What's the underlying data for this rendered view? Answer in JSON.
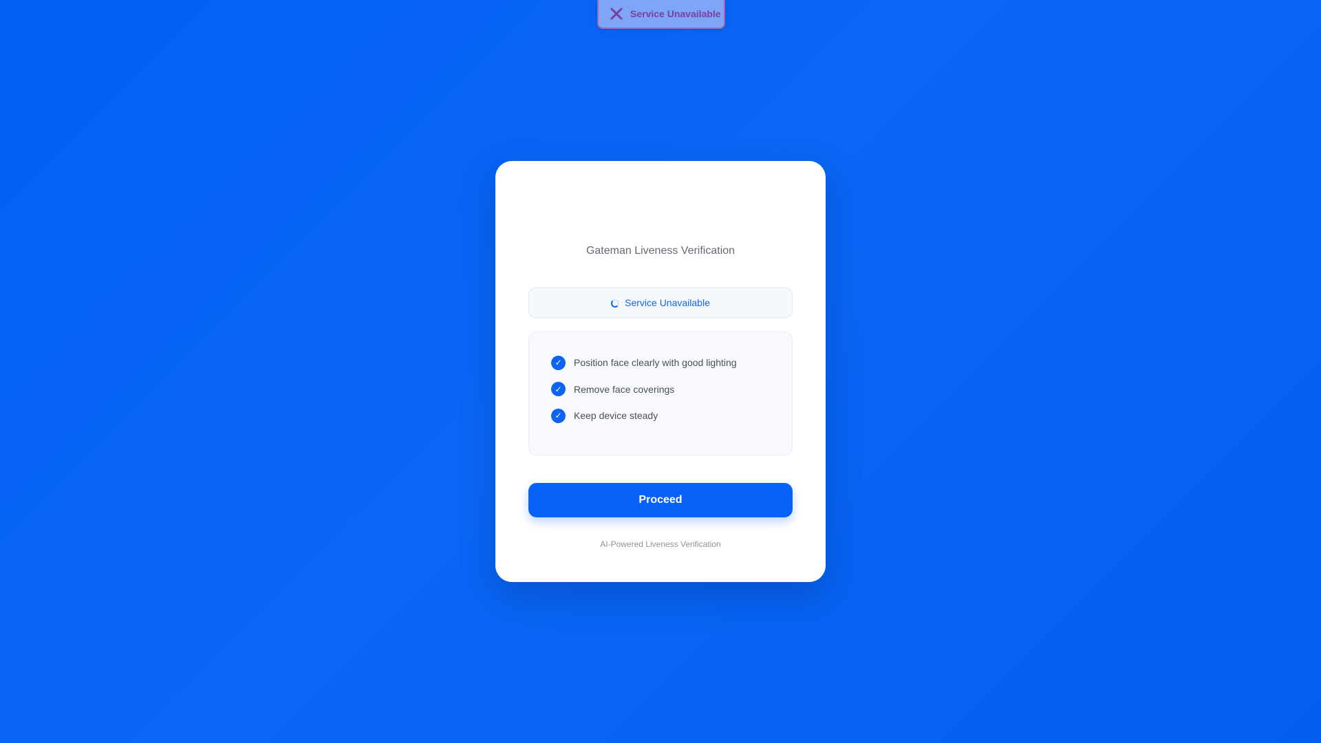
{
  "toast": {
    "icon": "close-x-icon",
    "message": "Service Unavailable",
    "color": "#7a3f9a"
  },
  "card": {
    "title": "Gateman Liveness Verification",
    "status": {
      "icon": "loading-spinner-icon",
      "text": "Service Unavailable"
    },
    "tips": [
      {
        "icon": "checkmark-icon",
        "text": "Position face clearly with good lighting"
      },
      {
        "icon": "checkmark-icon",
        "text": "Remove face coverings"
      },
      {
        "icon": "checkmark-icon",
        "text": "Keep device steady"
      }
    ],
    "proceed_label": "Proceed",
    "footer": "AI-Powered Liveness Verification"
  },
  "colors": {
    "background": "#0462f6",
    "accent": "#0561f7",
    "card": "#ffffff"
  }
}
